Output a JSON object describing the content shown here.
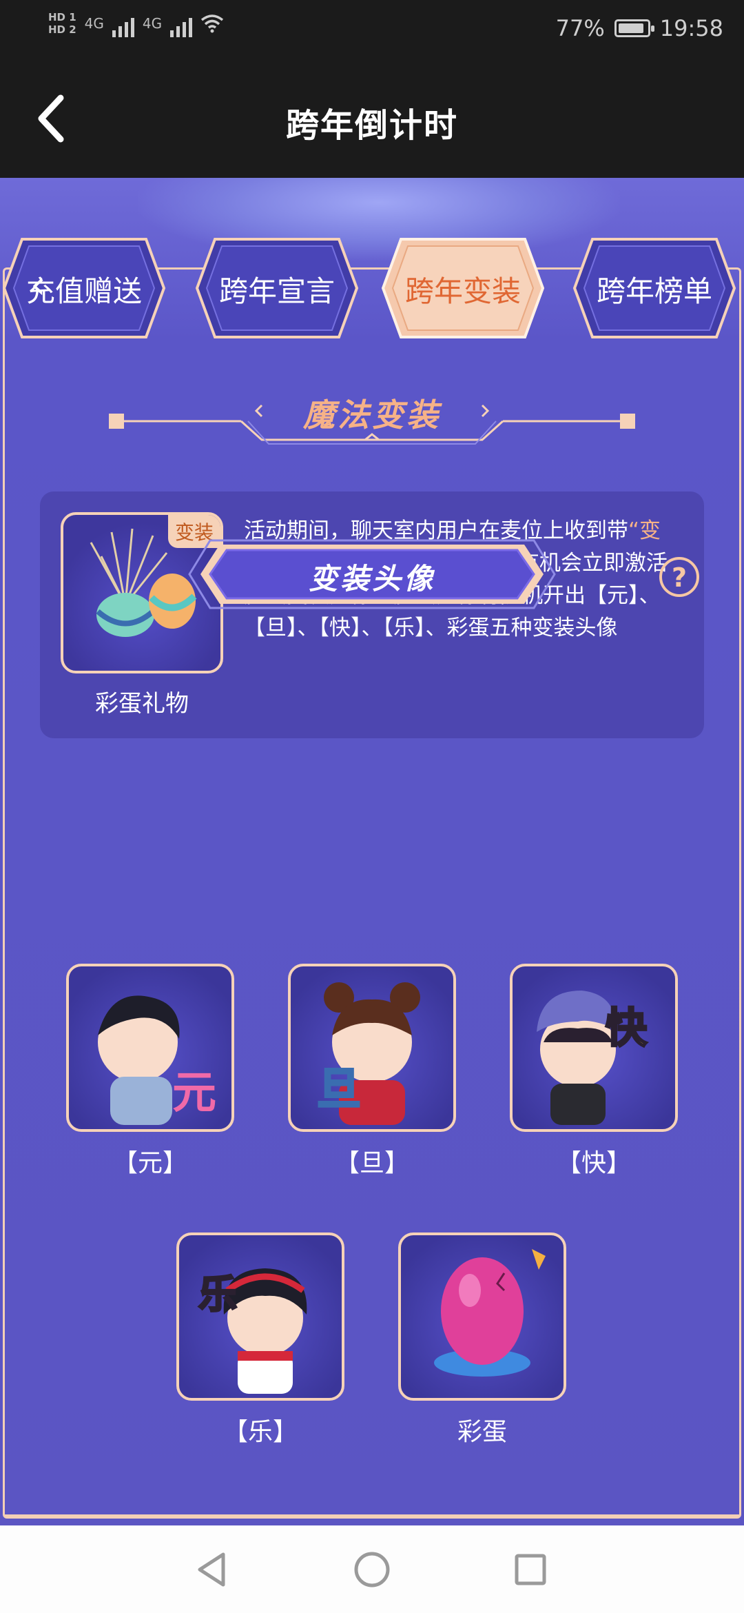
{
  "status_bar": {
    "hd1": "HD 1",
    "hd2": "HD 2",
    "network1": "4G",
    "network2": "4G",
    "battery": "77%",
    "time": "19:58"
  },
  "header": {
    "title": "跨年倒计时"
  },
  "tabs": [
    {
      "label": "充值赠送",
      "active": false
    },
    {
      "label": "跨年宣言",
      "active": false
    },
    {
      "label": "跨年变装",
      "active": true
    },
    {
      "label": "跨年榜单",
      "active": false
    }
  ],
  "section": {
    "title": "魔法变装"
  },
  "gift": {
    "tag": "变装",
    "label": "彩蛋礼物",
    "desc_part1": "活动期间，聊天室内用户在麦位上收到带",
    "desc_highlight": "“变装”",
    "desc_part2": "角标的【彩蛋】礼物， 将有机会立即激活魔法变装头像。魔法头像将随机开出【元】、【旦】、【快】、【乐】、彩蛋五种变装头像"
  },
  "avatar_button": {
    "label": "变装头像",
    "help": "?"
  },
  "avatars": [
    {
      "label": "【元】",
      "glyph": "元"
    },
    {
      "label": "【旦】",
      "glyph": "旦"
    },
    {
      "label": "【快】",
      "glyph": "快"
    },
    {
      "label": "【乐】",
      "glyph": "乐"
    },
    {
      "label": "彩蛋",
      "glyph": ""
    }
  ],
  "colors": {
    "accent": "#f6b287",
    "active_tab_text": "#e06733",
    "background": "#5b55c3"
  }
}
